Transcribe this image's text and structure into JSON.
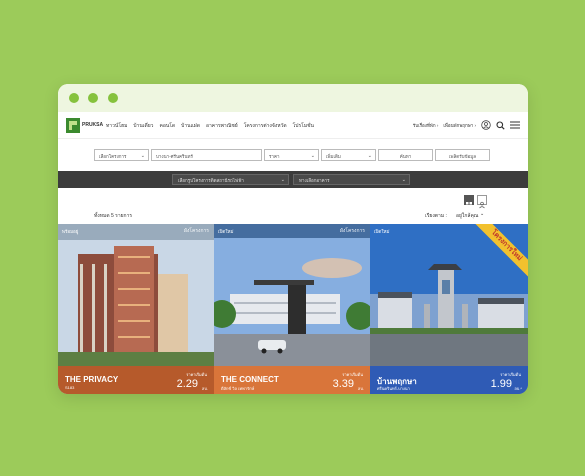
{
  "window": {
    "controls": [
      "close",
      "minimize",
      "maximize"
    ]
  },
  "nav": {
    "brand": "PRUKSA",
    "items": [
      "ทาวน์โฮม",
      "บ้านเดี่ยว",
      "คอนโด",
      "บ้านแฝด",
      "อาคารพาณิชย์",
      "โครงการต่างจังหวัด",
      "โปรโมชั่น"
    ],
    "right_links": [
      "รับเรื่องที่พัก",
      "เพื่อนพักพฤกษา"
    ],
    "icons": [
      "user-icon",
      "search-icon",
      "menu-icon"
    ]
  },
  "filters": {
    "type_placeholder": "เลือกโครงการ",
    "location_value": "บางนา-ศรีนครินทร์",
    "price_placeholder": "ราคา",
    "more_label": "เพิ่มเติม",
    "search_label": "ค้นหา",
    "contact_label": "เพลิดรับข้อมูล"
  },
  "darkbar": {
    "project_select": "เลือกรูปโครงการติดสถานีรถไฟฟ้า",
    "zone_select": "ทางเลือกอาคาร"
  },
  "toolbar": {
    "count": "ทั้งหมด 5 รายการ",
    "sort_label": "เรียงตาม :",
    "sort_value": "อยู่ใกล้คุณ"
  },
  "cards": [
    {
      "tag": "พร้อมอยู่",
      "plan": "ผังโครงการ",
      "name": "THE PRIVACY",
      "sub": "S183",
      "from": "ราคาเริ่มต้น",
      "price": "2.29",
      "unit": "ลบ.",
      "footer_color": "#b65a2b",
      "sky": "#c9d7e6",
      "building": "#8d4c3c"
    },
    {
      "tag": "เปิดใหม่",
      "plan": "ผังโครงการ",
      "name": "THE CONNECT",
      "sub": "ดีลักซ์ วิล เทพารักษ์",
      "from": "ราคาเริ่มต้น",
      "price": "3.39",
      "unit": "ลบ.",
      "footer_color": "#d9753a",
      "sky": "#86aee0",
      "building": "#e6e9ee"
    },
    {
      "tag": "เปิดใหม่",
      "plan": "ผังโครงการ",
      "name": "บ้านพฤกษา",
      "sub": "ศรีนครินทร์-บางนา",
      "from": "ราคาเริ่มต้น",
      "price": "1.99",
      "unit": "ลบ.*",
      "footer_color": "#2f5bb5",
      "sky": "#2f6fc4",
      "building": "#d9dde4",
      "ribbon": "โครงการใหม่"
    }
  ]
}
